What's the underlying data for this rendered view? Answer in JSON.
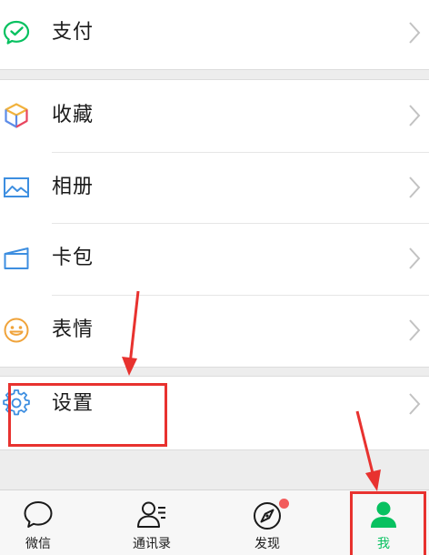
{
  "menu": {
    "pay": {
      "label": "支付",
      "icon": "wechat-pay-icon"
    },
    "favorites": {
      "label": "收藏",
      "icon": "favorites-cube-icon"
    },
    "album": {
      "label": "相册",
      "icon": "photo-album-icon"
    },
    "cards": {
      "label": "卡包",
      "icon": "card-wallet-icon"
    },
    "stickers": {
      "label": "表情",
      "icon": "smiley-icon"
    },
    "settings": {
      "label": "设置",
      "icon": "gear-icon"
    }
  },
  "tabbar": {
    "tabs": [
      {
        "label": "微信",
        "icon": "chat-bubble-icon",
        "active": false
      },
      {
        "label": "通讯录",
        "icon": "contacts-icon",
        "active": false
      },
      {
        "label": "发现",
        "icon": "compass-icon",
        "active": false,
        "badge": true
      },
      {
        "label": "我",
        "icon": "person-icon",
        "active": true
      }
    ]
  },
  "colors": {
    "accent": "#07c160",
    "annotation": "#e8322f",
    "badge": "#f25c5c",
    "chevron": "#c2c2c2"
  }
}
